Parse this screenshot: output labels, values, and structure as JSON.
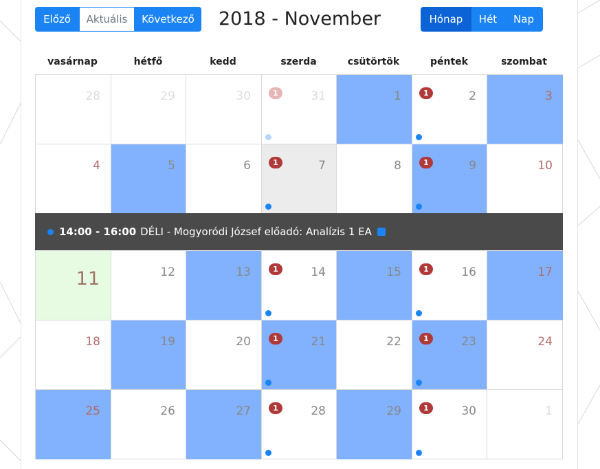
{
  "nav": {
    "prev": "Előző",
    "today": "Aktuális",
    "next": "Következő"
  },
  "title": "2018 - November",
  "views": {
    "month": "Hónap",
    "week": "Hét",
    "day": "Nap"
  },
  "weekdays": [
    "vasárnap",
    "hétfő",
    "kedd",
    "szerda",
    "csütörtök",
    "péntek",
    "szombat"
  ],
  "badge_text": "1",
  "weeks": [
    [
      {
        "n": "28",
        "faded": true
      },
      {
        "n": "29",
        "faded": true
      },
      {
        "n": "30",
        "faded": true
      },
      {
        "n": "31",
        "faded": true,
        "badge": true,
        "dot": true
      },
      {
        "n": "1",
        "highlight": true
      },
      {
        "n": "2",
        "badge": true,
        "dot": true
      },
      {
        "n": "3",
        "highlight": true,
        "red": true
      }
    ],
    [
      {
        "n": "4",
        "red": true
      },
      {
        "n": "5",
        "highlight": true
      },
      {
        "n": "6"
      },
      {
        "n": "7",
        "gray": true,
        "badge": true,
        "dot": true
      },
      {
        "n": "8"
      },
      {
        "n": "9",
        "highlight": true,
        "badge": true,
        "dot": true
      },
      {
        "n": "10",
        "red": true
      }
    ],
    [
      {
        "n": "11",
        "today": true,
        "big": true
      },
      {
        "n": "12"
      },
      {
        "n": "13",
        "highlight": true
      },
      {
        "n": "14",
        "badge": true,
        "dot": true
      },
      {
        "n": "15",
        "highlight": true
      },
      {
        "n": "16",
        "badge": true,
        "dot": true
      },
      {
        "n": "17",
        "highlight": true,
        "red": true
      }
    ],
    [
      {
        "n": "18",
        "red": true
      },
      {
        "n": "19",
        "highlight": true
      },
      {
        "n": "20"
      },
      {
        "n": "21",
        "highlight": true,
        "badge": true,
        "dot": true
      },
      {
        "n": "22"
      },
      {
        "n": "23",
        "highlight": true,
        "badge": true,
        "dot": true
      },
      {
        "n": "24",
        "red": true
      }
    ],
    [
      {
        "n": "25",
        "highlight": true,
        "red": true
      },
      {
        "n": "26"
      },
      {
        "n": "27",
        "highlight": true
      },
      {
        "n": "28",
        "badge": true,
        "dot": true
      },
      {
        "n": "29",
        "highlight": true
      },
      {
        "n": "30",
        "badge": true,
        "dot": true
      },
      {
        "n": "1",
        "faded": true
      }
    ]
  ],
  "event": {
    "time": "14:00 - 16:00",
    "text": "DÉLI - Mogyoródi József előadó: Analízis 1 EA"
  },
  "colors": {
    "primary": "#1b84f5",
    "highlight": "#82b1fd",
    "badge": "#b03a3a",
    "event_bar": "#4a4a4a",
    "today": "#e7fbe3"
  }
}
